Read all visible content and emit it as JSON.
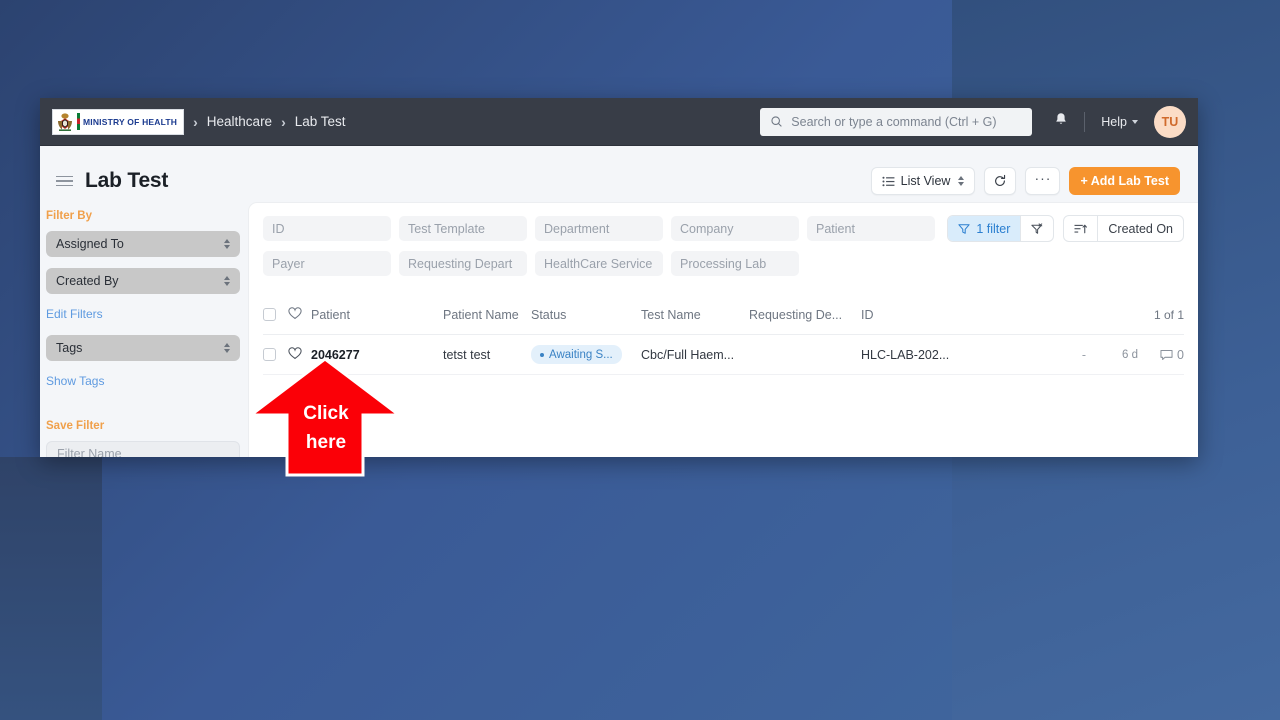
{
  "navbar": {
    "logo_text": "MINISTRY OF HEALTH",
    "breadcrumb": [
      "Healthcare",
      "Lab Test"
    ],
    "separator": "›",
    "search_placeholder": "Search or type a command (Ctrl + G)",
    "help_label": "Help",
    "avatar_initials": "TU"
  },
  "page": {
    "title": "Lab Test",
    "view_button": "List View",
    "refresh_icon": "refresh-icon",
    "more_button": "···",
    "add_button": "+ Add Lab Test"
  },
  "sidebar": {
    "filter_by_label": "Filter By",
    "selects": [
      {
        "label": "Assigned To"
      },
      {
        "label": "Created By"
      }
    ],
    "edit_filters_link": "Edit Filters",
    "tags_select": "Tags",
    "show_tags_link": "Show Tags",
    "save_filter_label": "Save Filter",
    "filter_name_placeholder": "Filter Name"
  },
  "filters": {
    "row1": [
      "ID",
      "Test Template",
      "Department",
      "Company",
      "Patient"
    ],
    "row2": [
      "Payer",
      "Requesting Depart",
      "HealthCare Service",
      "Processing Lab"
    ],
    "filter_count_label": "1 filter",
    "clear_filter_icon": "filter-clear-icon",
    "sort_icon": "sort-ascending-icon",
    "sort_field": "Created On"
  },
  "table": {
    "headers": {
      "patient": "Patient",
      "patient_name": "Patient Name",
      "status": "Status",
      "test_name": "Test Name",
      "requesting_dep": "Requesting De...",
      "id": "ID",
      "count": "1 of 1"
    },
    "rows": [
      {
        "patient": "2046277",
        "patient_name": "tetst test",
        "status": "Awaiting S...",
        "test_name": "Cbc/Full Haem...",
        "requesting_dep": "",
        "id": "HLC-LAB-202...",
        "assigned": "-",
        "age": "6 d",
        "comments": "0"
      }
    ]
  },
  "annotation": {
    "line1": "Click",
    "line2": "here",
    "color": "#fb0007"
  },
  "colors": {
    "accent": "#f7942e",
    "navbar": "#383d47",
    "link": "#5e9ae0",
    "badge_bg": "#e3f0fb",
    "badge_text": "#3a82c4"
  }
}
